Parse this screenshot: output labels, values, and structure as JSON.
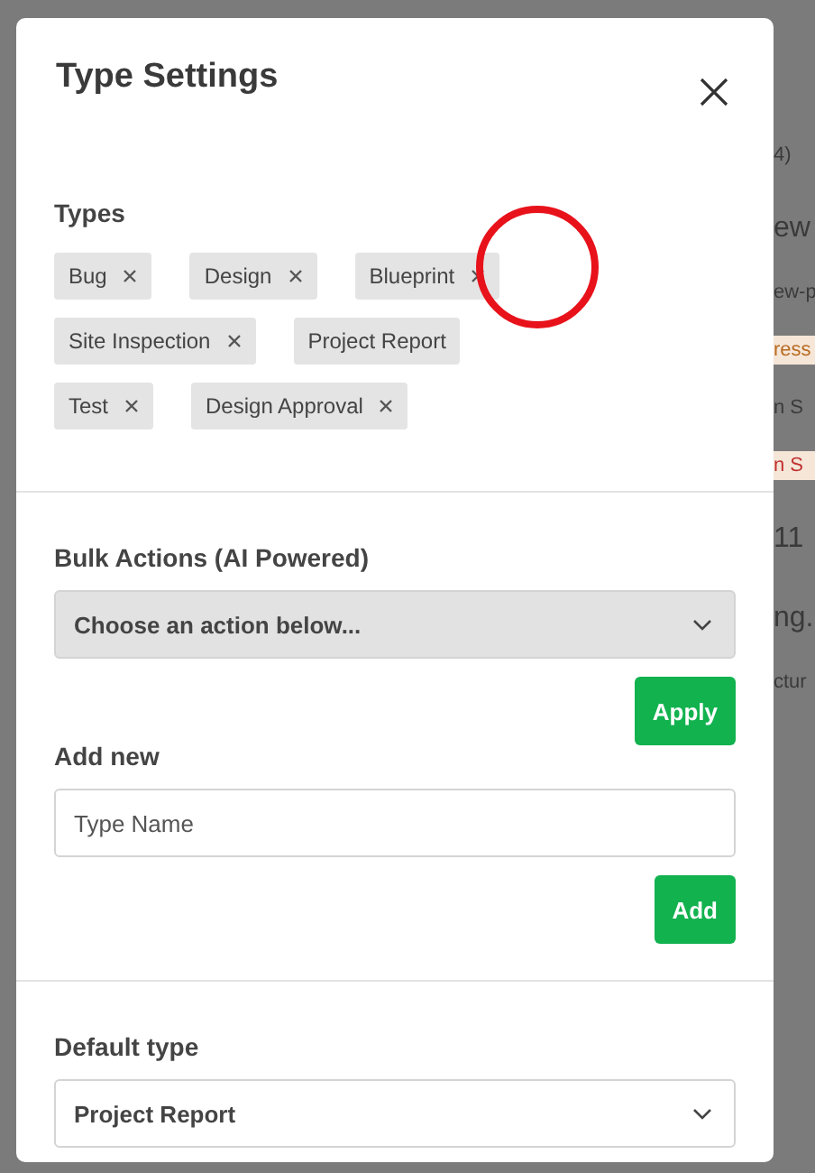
{
  "backdrop": {
    "fragments": [
      {
        "kind": "text",
        "text": "4)"
      },
      {
        "kind": "large",
        "text": "ew"
      },
      {
        "kind": "text",
        "text": "ew-p"
      },
      {
        "kind": "badge",
        "text": "ress",
        "color": "#b86a20"
      },
      {
        "kind": "text",
        "text": "n S"
      },
      {
        "kind": "badge",
        "text": "n S",
        "color": "#c03030"
      },
      {
        "kind": "large",
        "text": "11"
      },
      {
        "kind": "large",
        "text": "ng."
      },
      {
        "kind": "text",
        "text": "ctur"
      }
    ]
  },
  "modal": {
    "title": "Type Settings",
    "types": {
      "label": "Types",
      "items": [
        {
          "label": "Bug",
          "removable": true
        },
        {
          "label": "Design",
          "removable": true
        },
        {
          "label": "Blueprint",
          "removable": true
        },
        {
          "label": "Site Inspection",
          "removable": true
        },
        {
          "label": "Project Report",
          "removable": false
        },
        {
          "label": "Test",
          "removable": true
        },
        {
          "label": "Design Approval",
          "removable": true
        }
      ]
    },
    "bulk_actions": {
      "label": "Bulk Actions (AI Powered)",
      "value": "Choose an action below...",
      "button": "Apply"
    },
    "add_new": {
      "label": "Add new",
      "placeholder": "Type Name",
      "button": "Add"
    },
    "default_type": {
      "label": "Default type",
      "value": "Project Report"
    }
  },
  "annotation": {
    "kind": "circle",
    "color": "#e8121b"
  }
}
